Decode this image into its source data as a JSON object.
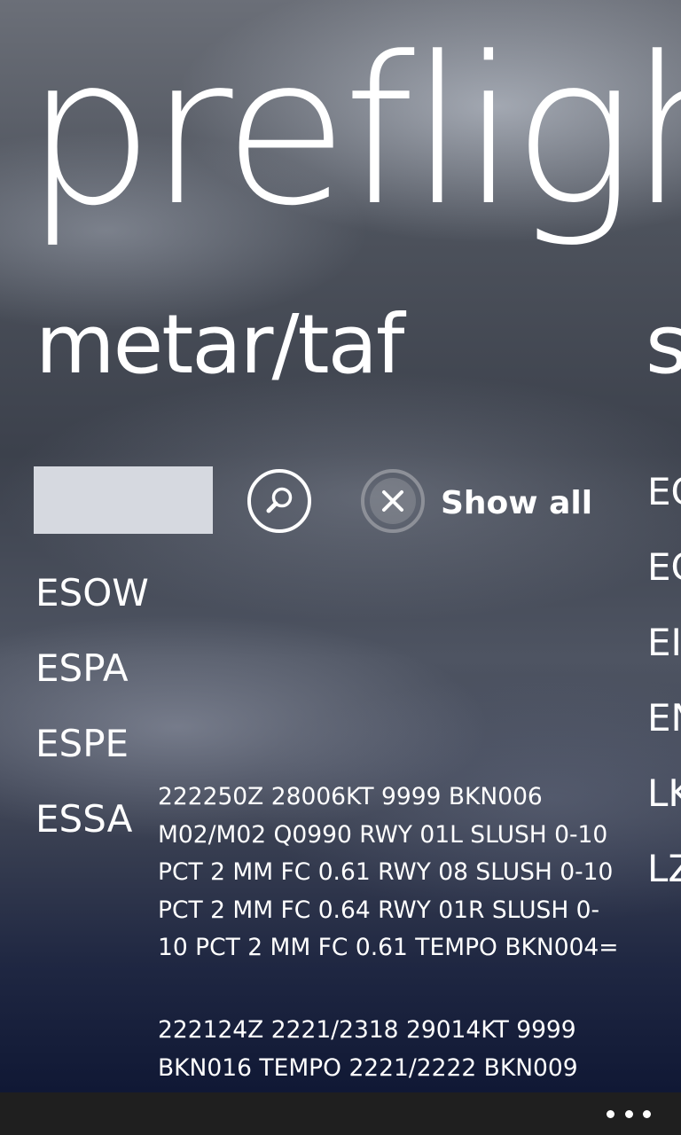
{
  "app": {
    "title": "preflight"
  },
  "pivots": [
    {
      "header": "metar/taf"
    },
    {
      "header": "s"
    }
  ],
  "search": {
    "value": "",
    "placeholder": ""
  },
  "icons": {
    "search": "search-icon",
    "clear": "close-icon",
    "more": "more-icon"
  },
  "show_all": {
    "label": "Show all"
  },
  "stations": [
    {
      "code": "ESOW"
    },
    {
      "code": "ESPA"
    },
    {
      "code": "ESPE"
    },
    {
      "code": "ESSA"
    }
  ],
  "selected_station": {
    "code": "ESSA",
    "metar": "222250Z 28006KT 9999 BKN006 M02/M02 Q0990 RWY 01L SLUSH 0-10 PCT 2 MM FC 0.61 RWY 08 SLUSH 0-10 PCT 2 MM FC 0.64 RWY 01R SLUSH 0-10 PCT 2 MM FC 0.61 TEMPO BKN004=",
    "taf": "222124Z 2221/2318 29014KT 9999 BKN016 TEMPO 2221/2222 BKN009"
  },
  "next_pivot_stations": [
    {
      "code": "EG"
    },
    {
      "code": "EG"
    },
    {
      "code": "EI"
    },
    {
      "code": "EN"
    },
    {
      "code": "LK"
    },
    {
      "code": "LZ"
    }
  ],
  "colors": {
    "text": "#ffffff",
    "search_box": "#d6d9e0",
    "app_bar": "#1f1f1f",
    "clear_ring": "#8d9098"
  }
}
